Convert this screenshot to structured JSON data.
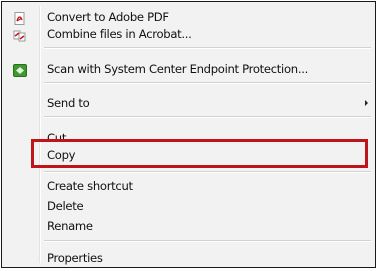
{
  "menu": {
    "items": [
      {
        "label": "Convert to Adobe PDF",
        "icon": "adobe-pdf-icon"
      },
      {
        "label": "Combine files in Acrobat...",
        "icon": "acrobat-combine-icon"
      },
      {
        "label": "Scan with System Center Endpoint Protection...",
        "icon": "endpoint-protection-icon"
      },
      {
        "label": "Send to",
        "icon": "submenu-arrow-icon"
      },
      {
        "label": "Cut"
      },
      {
        "label": "Copy",
        "highlighted": true
      },
      {
        "label": "Create shortcut"
      },
      {
        "label": "Delete"
      },
      {
        "label": "Rename"
      },
      {
        "label": "Properties"
      }
    ]
  },
  "colors": {
    "menu_background": "#f2f2f2",
    "highlight_border": "#c0141b",
    "pdf_red": "#c8151d",
    "endpoint_green": "#3e9a2e"
  }
}
